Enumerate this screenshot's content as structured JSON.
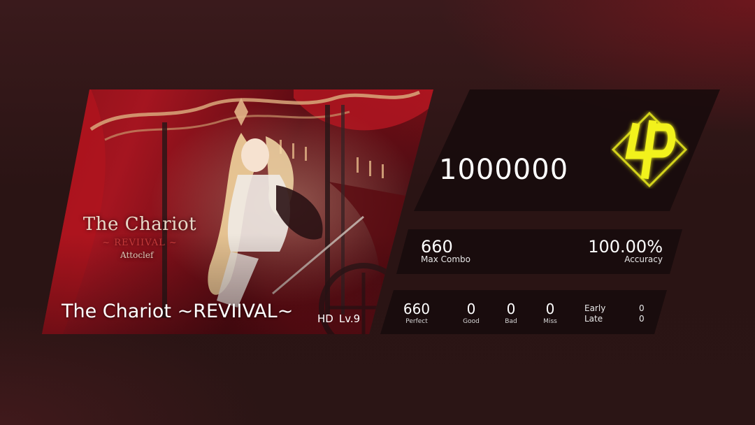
{
  "jacket": {
    "art_title": "The Chariot",
    "art_subtitle": "~ REVIIVAL ~",
    "art_artist": "Attoclef"
  },
  "song": {
    "title": "The Chariot ~REVIIVAL~",
    "difficulty": "HD",
    "level": "Lv.9"
  },
  "result": {
    "score": "1000000",
    "rank_badge_icon": "phi-rank-icon",
    "rank_color": "#f2f21a",
    "max_combo": "660",
    "max_combo_label": "Max Combo",
    "accuracy": "100.00%",
    "accuracy_label": "Accuracy"
  },
  "judgements": [
    {
      "value": "660",
      "label": "Perfect"
    },
    {
      "value": "0",
      "label": "Good"
    },
    {
      "value": "0",
      "label": "Bad"
    },
    {
      "value": "0",
      "label": "Miss"
    }
  ],
  "timing": {
    "early_label": "Early",
    "early_value": "0",
    "late_label": "Late",
    "late_value": "0"
  },
  "colors": {
    "background": "#2a1414",
    "accent_red": "#a51520",
    "panel": "#16090b"
  }
}
